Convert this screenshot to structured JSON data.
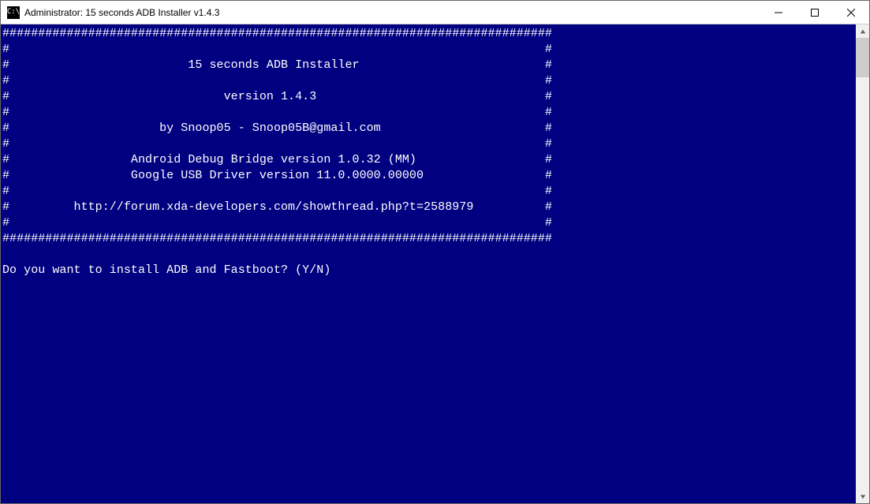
{
  "window": {
    "icon_text": "C:\\",
    "title": "Administrator:  15 seconds ADB Installer v1.4.3"
  },
  "console": {
    "lines": [
      "#############################################################################",
      "#                                                                           #",
      "#                         15 seconds ADB Installer                          #",
      "#                                                                           #",
      "#                              version 1.4.3                                #",
      "#                                                                           #",
      "#                     by Snoop05 - Snoop05B@gmail.com                       #",
      "#                                                                           #",
      "#                 Android Debug Bridge version 1.0.32 (MM)                  #",
      "#                 Google USB Driver version 11.0.0000.00000                 #",
      "#                                                                           #",
      "#         http://forum.xda-developers.com/showthread.php?t=2588979          #",
      "#                                                                           #",
      "#############################################################################",
      "",
      "Do you want to install ADB and Fastboot? (Y/N)"
    ]
  }
}
